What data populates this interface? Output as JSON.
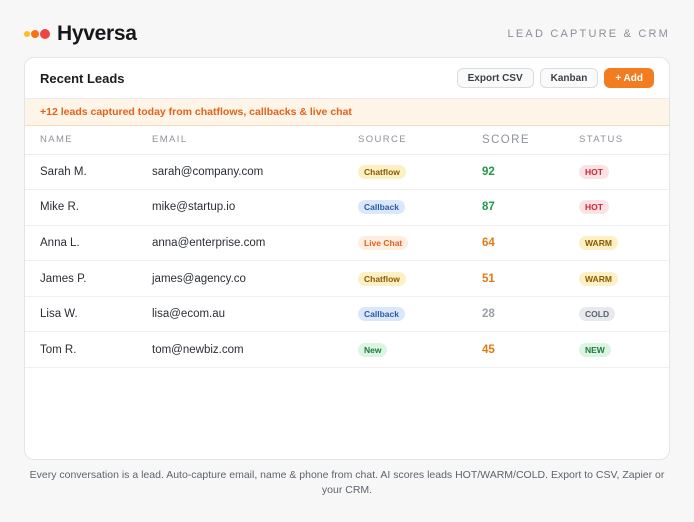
{
  "brand": {
    "name": "Hyversa",
    "tagline": "LEAD CAPTURE & CRM"
  },
  "card": {
    "title": "Recent Leads",
    "buttons": {
      "export": "Export CSV",
      "kanban": "Kanban",
      "add": "+ Add"
    },
    "banner": "+12 leads captured today from chatflows, callbacks & live chat"
  },
  "table": {
    "headers": {
      "name": "NAME",
      "email": "EMAIL",
      "source": "SOURCE",
      "score": "SCORE",
      "status": "STATUS"
    },
    "rows": [
      {
        "name": "Sarah M.",
        "email": "sarah@company.com",
        "source": "Chatflow",
        "score": "92",
        "status": "HOT"
      },
      {
        "name": "Mike R.",
        "email": "mike@startup.io",
        "source": "Callback",
        "score": "87",
        "status": "HOT"
      },
      {
        "name": "Anna L.",
        "email": "anna@enterprise.com",
        "source": "Live Chat",
        "score": "64",
        "status": "WARM"
      },
      {
        "name": "James P.",
        "email": "james@agency.co",
        "source": "Chatflow",
        "score": "51",
        "status": "WARM"
      },
      {
        "name": "Lisa W.",
        "email": "lisa@ecom.au",
        "source": "Callback",
        "score": "28",
        "status": "COLD"
      },
      {
        "name": "Tom R.",
        "email": "tom@newbiz.com",
        "source": "New",
        "score": "45",
        "status": "NEW"
      }
    ]
  },
  "colors": {
    "accent": "#f47c20",
    "score_high": "#1f9a48",
    "score_mid": "#e07b12",
    "score_low": "#9aa0a8"
  },
  "footer": "Every conversation is a lead. Auto-capture email, name & phone from chat. AI scores leads HOT/WARM/COLD. Export to CSV, Zapier or your CRM."
}
